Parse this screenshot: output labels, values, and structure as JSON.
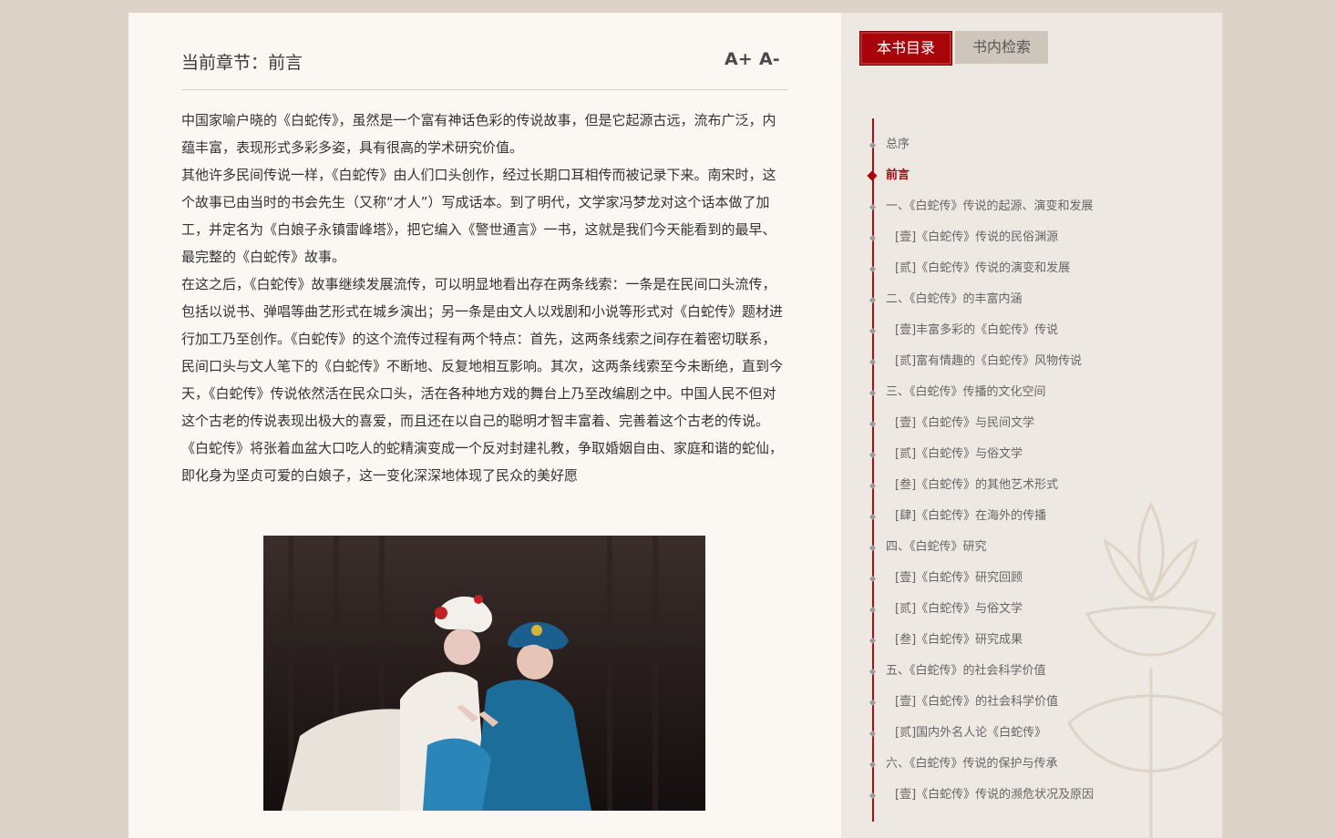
{
  "chapter": {
    "label": "当前章节：前言",
    "font_increase": "A+",
    "font_decrease": "A-"
  },
  "article": {
    "paragraphs": [
      "中国家喻户晓的《白蛇传》，虽然是一个富有神话色彩的传说故事，但是它起源古远，流布广泛，内蕴丰富，表现形式多彩多姿，具有很高的学术研究价值。",
      "其他许多民间传说一样，《白蛇传》由人们口头创作，经过长期口耳相传而被记录下来。南宋时，这个故事已由当时的书会先生（又称“才人”）写成话本。到了明代，文学家冯梦龙对这个话本做了加工，并定名为《白娘子永镇雷峰塔》，把它编入《警世通言》一书，这就是我们今天能看到的最早、最完整的《白蛇传》故事。",
      "在这之后，《白蛇传》故事继续发展流传，可以明显地看出存在两条线索：一条是在民间口头流传，包括以说书、弹唱等曲艺形式在城乡演出；另一条是由文人以戏剧和小说等形式对《白蛇传》题材进行加工乃至创作。《白蛇传》的这个流传过程有两个特点：首先，这两条线索之间存在着密切联系，民间口头与文人笔下的《白蛇传》不断地、反复地相互影响。其次，这两条线索至今未断绝，直到今天，《白蛇传》传说依然活在民众口头，活在各种地方戏的舞台上乃至改编剧之中。中国人民不但对这个古老的传说表现出极大的喜爱，而且还在以自己的聪明才智丰富着、完善着这个古老的传说。",
      "《白蛇传》将张着血盆大口吃人的蛇精演变成一个反对封建礼教，争取婚姻自由、家庭和谐的蛇仙，即化身为坚贞可爱的白娘子，这一变化深深地体现了民众的美好愿"
    ]
  },
  "tabs": {
    "toc": "本书目录",
    "search": "书内检索"
  },
  "toc": [
    {
      "label": "总序",
      "sub": false
    },
    {
      "label": "前言",
      "sub": false,
      "active": true
    },
    {
      "label": "一、《白蛇传》传说的起源、演变和发展",
      "sub": false
    },
    {
      "label": "[壹]《白蛇传》传说的民俗渊源",
      "sub": true
    },
    {
      "label": "[贰]《白蛇传》传说的演变和发展",
      "sub": true
    },
    {
      "label": "二、《白蛇传》的丰富内涵",
      "sub": false
    },
    {
      "label": "[壹]丰富多彩的《白蛇传》传说",
      "sub": true
    },
    {
      "label": "[贰]富有情趣的《白蛇传》风物传说",
      "sub": true
    },
    {
      "label": "三、《白蛇传》传播的文化空间",
      "sub": false
    },
    {
      "label": "[壹]《白蛇传》与民间文学",
      "sub": true
    },
    {
      "label": "[贰]《白蛇传》与俗文学",
      "sub": true
    },
    {
      "label": "[叁]《白蛇传》的其他艺术形式",
      "sub": true
    },
    {
      "label": "[肆]《白蛇传》在海外的传播",
      "sub": true
    },
    {
      "label": "四、《白蛇传》研究",
      "sub": false
    },
    {
      "label": "[壹]《白蛇传》研究回顾",
      "sub": true
    },
    {
      "label": "[贰]《白蛇传》与俗文学",
      "sub": true
    },
    {
      "label": "[叁]《白蛇传》研究成果",
      "sub": true
    },
    {
      "label": "五、《白蛇传》的社会科学价值",
      "sub": false
    },
    {
      "label": "[壹]《白蛇传》的社会科学价值",
      "sub": true
    },
    {
      "label": "[贰]国内外名人论《白蛇传》",
      "sub": true
    },
    {
      "label": "六、《白蛇传》传说的保护与传承",
      "sub": false
    },
    {
      "label": "[壹]《白蛇传》传说的濒危状况及原因",
      "sub": true
    }
  ],
  "colors": {
    "accent": "#a8050b",
    "sidebar_bg": "#ede8e1",
    "page_bg": "#ddd3c8"
  }
}
